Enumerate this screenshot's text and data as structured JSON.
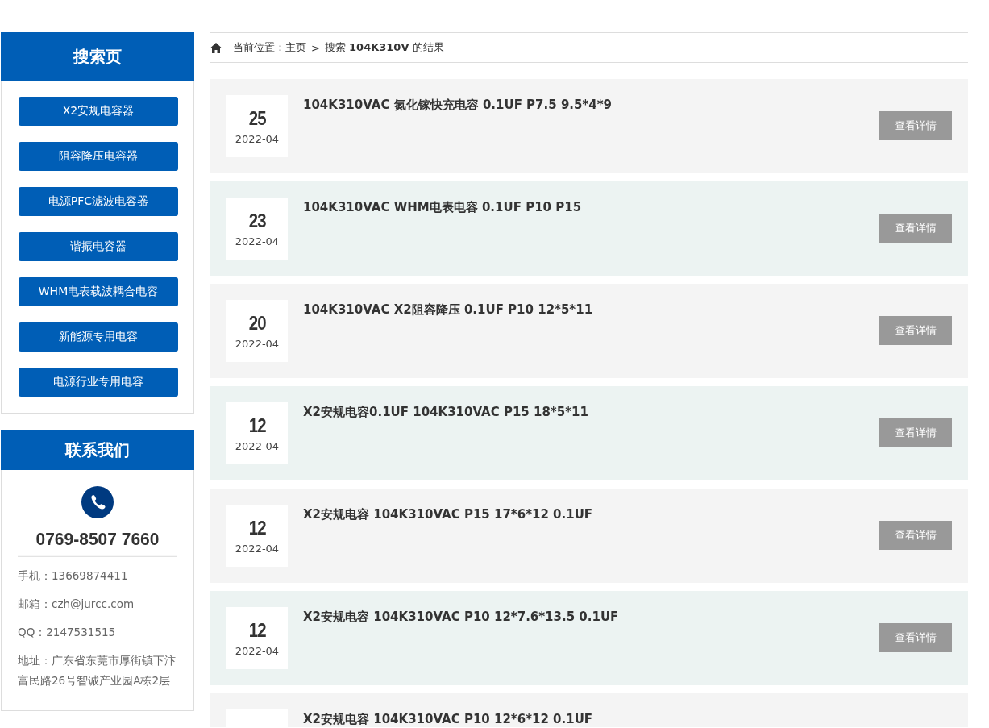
{
  "sidebar": {
    "search_panel": {
      "title": "搜索页",
      "categories": [
        "X2安规电容器",
        "阻容降压电容器",
        "电源PFC滤波电容器",
        "谐振电容器",
        "WHM电表载波耦合电容",
        "新能源专用电容",
        "电源行业专用电容"
      ]
    },
    "contact_panel": {
      "title": "联系我们",
      "hotline": "0769-8507 7660",
      "details": [
        "手机：13669874411",
        "邮箱：czh@jurcc.com",
        "QQ：2147531515",
        "地址：广东省东莞市厚街镇下汴富民路26号智诚产业园A栋2层"
      ]
    }
  },
  "breadcrumb": {
    "label": "当前位置：",
    "home": "主页",
    "separator": ">",
    "current": "搜索 **104K310V** 的结果"
  },
  "results": [
    {
      "day": "25",
      "month": "2022-04",
      "title": "104K310VAC 氮化镓快充电容 0.1UF P7.5 9.5*4*9",
      "button": "查看详情"
    },
    {
      "day": "23",
      "month": "2022-04",
      "title": "104K310VAC WHM电表电容 0.1UF P10 P15",
      "button": "查看详情"
    },
    {
      "day": "20",
      "month": "2022-04",
      "title": "104K310VAC X2阻容降压 0.1UF P10 12*5*11",
      "button": "查看详情"
    },
    {
      "day": "12",
      "month": "2022-04",
      "title": "X2安规电容0.1UF 104K310VAC P15 18*5*11",
      "button": "查看详情"
    },
    {
      "day": "12",
      "month": "2022-04",
      "title": "X2安规电容 104K310VAC P15 17*6*12 0.1UF",
      "button": "查看详情"
    },
    {
      "day": "12",
      "month": "2022-04",
      "title": "X2安规电容 104K310VAC P10 12*7.6*13.5 0.1UF",
      "button": "查看详情"
    },
    {
      "title": "X2安规电容 104K310VAC P10 12*6*12 0.1UF"
    }
  ]
}
